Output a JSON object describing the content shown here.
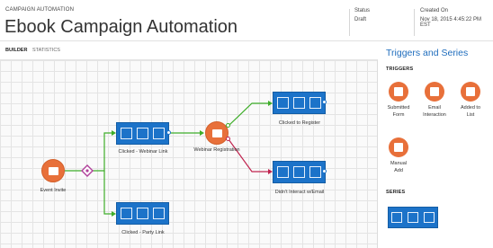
{
  "header": {
    "breadcrumb": "CAMPAIGN AUTOMATION",
    "title": "Ebook Campaign Automation",
    "status_label": "Status",
    "status_value": "Draft",
    "created_label": "Created On",
    "created_value": "Nov 18, 2015 4:45:22 PM EST"
  },
  "tabs": [
    {
      "label": "BUILDER",
      "active": true
    },
    {
      "label": "STATISTICS",
      "active": false
    }
  ],
  "canvas": {
    "nodes": {
      "event_invite": "Event Invite",
      "clicked_webinar": "Clicked - Webinar Link",
      "clicked_party": "Clicked - Party Link",
      "webinar_registration": "Webinar Registration",
      "clicked_register": "Clicked to Register",
      "didnt_interact": "Didn't Interact w/Email"
    },
    "colors": {
      "tile": "#1c73c9",
      "action": "#e8703a",
      "yes_path": "#3fae2a",
      "no_path": "#c0244f",
      "split": "#b03f9a"
    }
  },
  "panel": {
    "title": "Triggers and Series",
    "triggers_heading": "TRIGGERS",
    "triggers": [
      {
        "label1": "Submitted",
        "label2": "Form",
        "icon": "form-icon"
      },
      {
        "label1": "Email",
        "label2": "Interaction",
        "icon": "email-icon"
      },
      {
        "label1": "Added to",
        "label2": "List",
        "icon": "list-icon"
      },
      {
        "label1": "Manual",
        "label2": "Add",
        "icon": "manual-add-icon"
      }
    ],
    "series_heading": "SERIES"
  }
}
